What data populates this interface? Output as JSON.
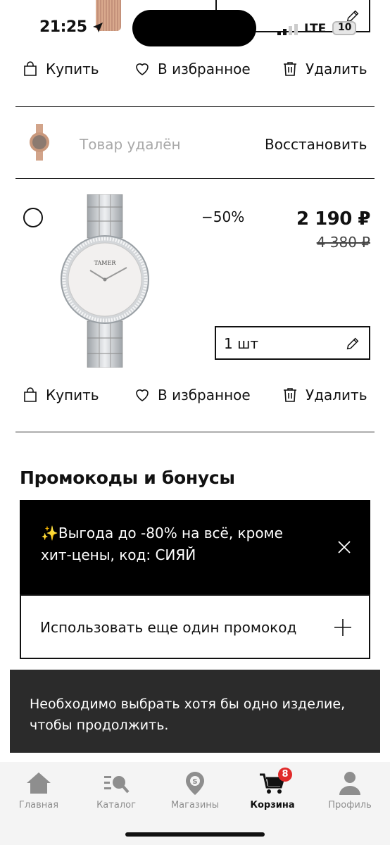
{
  "status_bar": {
    "time": "21:25",
    "network": "LTE",
    "battery": "10"
  },
  "top_item_actions": {
    "buy": "Купить",
    "favorite": "В избранное",
    "delete": "Удалить"
  },
  "deleted_item": {
    "label": "Товар удалён",
    "restore": "Восстановить"
  },
  "product": {
    "discount": "−50%",
    "price": "2 190 ₽",
    "old_price": "4 380 ₽",
    "quantity": "1 шт",
    "brand_on_dial": "TAMER",
    "actions": {
      "buy": "Купить",
      "favorite": "В избранное",
      "delete": "Удалить"
    }
  },
  "promo": {
    "title": "Промокоды и бонусы",
    "banner_text": "✨Выгода до -80% на всё, кроме хит-цены, код: СИЯЙ",
    "add_code": "Использовать еще один промокод"
  },
  "toast": {
    "message": "Необходимо выбрать хотя бы одно изделие, чтобы продолжить."
  },
  "tabbar": {
    "tabs": [
      {
        "label": "Главная",
        "icon": "home-icon"
      },
      {
        "label": "Каталог",
        "icon": "catalog-icon"
      },
      {
        "label": "Магазины",
        "icon": "store-pin-icon"
      },
      {
        "label": "Корзина",
        "icon": "cart-icon",
        "badge": "8",
        "active": true
      },
      {
        "label": "Профиль",
        "icon": "profile-icon"
      }
    ]
  }
}
